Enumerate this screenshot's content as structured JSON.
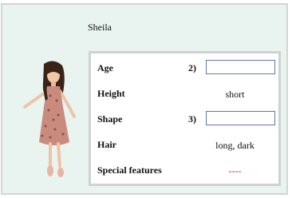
{
  "person": {
    "name": "Sheila",
    "image_description": "girl-in-pink-floral-dress"
  },
  "table": {
    "rows": [
      {
        "label": "Age",
        "number": "2)",
        "input_value": ""
      },
      {
        "label": "Height",
        "value": "short"
      },
      {
        "label": "Shape",
        "number": "3)",
        "input_value": ""
      },
      {
        "label": "Hair",
        "value": "long, dark"
      },
      {
        "label": "Special features",
        "value": "----"
      }
    ]
  },
  "colors": {
    "card_bg": "#e9f4f1",
    "input_border": "#5e77a8",
    "dash_color": "#d81b22"
  }
}
